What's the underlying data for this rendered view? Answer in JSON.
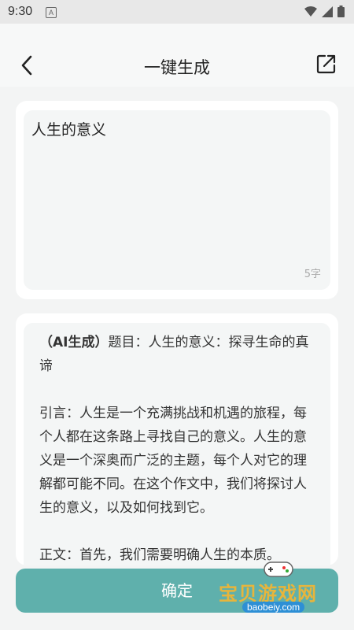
{
  "status": {
    "time": "9:30",
    "notice_glyph": "A"
  },
  "header": {
    "title": "一键生成"
  },
  "input": {
    "text": "人生的意义",
    "char_count": "5字"
  },
  "result": {
    "ai_tag": "（AI生成）",
    "paragraphs": [
      "题目：人生的意义：探寻生命的真谛",
      "引言：人生是一个充满挑战和机遇的旅程，每个人都在这条路上寻找自己的意义。人生的意义是一个深奥而广泛的主题，每个人对它的理解都可能不同。在这个作文中，我们将探讨人生的意义，以及如何找到它。",
      "正文：首先，我们需要明确人生的本质。"
    ]
  },
  "footer": {
    "confirm_label": "确定"
  },
  "watermark": {
    "text": "宝贝游戏网",
    "url": "baobeiy.com"
  }
}
